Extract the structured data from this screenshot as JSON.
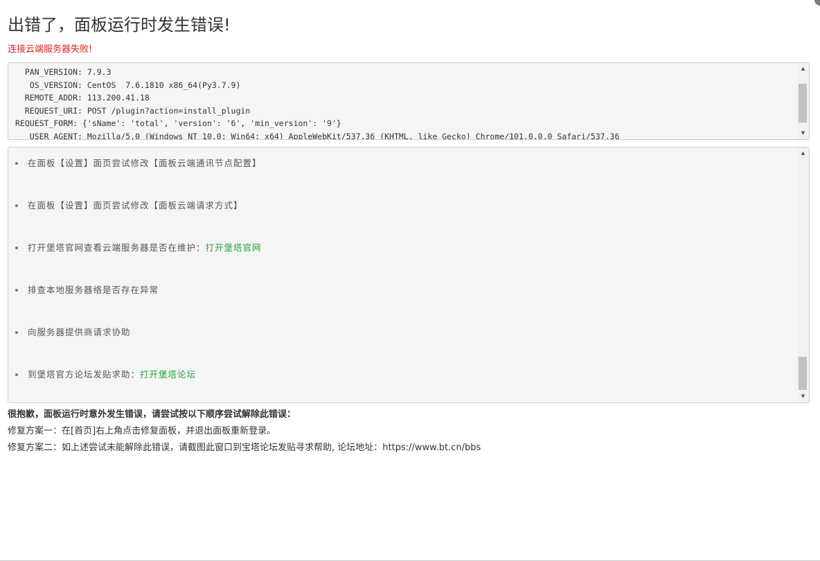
{
  "header": {
    "title": "出错了，面板运行时发生错误!",
    "subtitle": "连接云端服务器失败!"
  },
  "info_panel": {
    "lines": [
      "  PAN_VERSION: 7.9.3",
      "   OS_VERSION: CentOS  7.6.1810 x86_64(Py3.7.9)",
      "  REMOTE_ADDR: 113.200.41.18",
      "  REQUEST_URI: POST /plugin?action=install_plugin",
      "REQUEST_FORM: {'sName': 'total', 'version': '6', 'min_version': '9'}",
      "   USER_AGENT: Mozilla/5.0 (Windows NT 10.0; Win64; x64) AppleWebKit/537.36 (KHTML, like Gecko) Chrome/101.0.0.0 Safari/537.36"
    ]
  },
  "tips": [
    {
      "text": "在面板【设置】面页尝试修改【面板云端通讯节点配置】",
      "link": ""
    },
    {
      "text": "在面板【设置】面页尝试修改【面板云端请求方式】",
      "link": ""
    },
    {
      "text": "打开堡塔官网查看云端服务器是否在维护：",
      "link": "打开堡塔官网"
    },
    {
      "text": "排查本地服务器络是否存在异常",
      "link": ""
    },
    {
      "text": "向服务器提供商请求协助",
      "link": ""
    },
    {
      "text": "到堡塔官方论坛发贴求助：",
      "link": "打开堡塔论坛"
    }
  ],
  "footer": {
    "sorry": "很抱歉，面板运行时意外发生错误，请尝试按以下顺序尝试解除此错误：",
    "plan1": "修复方案一：在[首页]右上角点击修复面板，并退出面板重新登录。",
    "plan2": "修复方案二：如上述尝试未能解除此错误，请截图此窗口到宝塔论坛发贴寻求帮助, 论坛地址：https://www.bt.cn/bbs"
  },
  "icons": {
    "scroll_up": "scroll-up-arrow",
    "scroll_down": "scroll-down-arrow"
  },
  "colors": {
    "error_red": "#e02020",
    "link_green": "#20a53a",
    "panel_bg": "#f5f5f5"
  }
}
